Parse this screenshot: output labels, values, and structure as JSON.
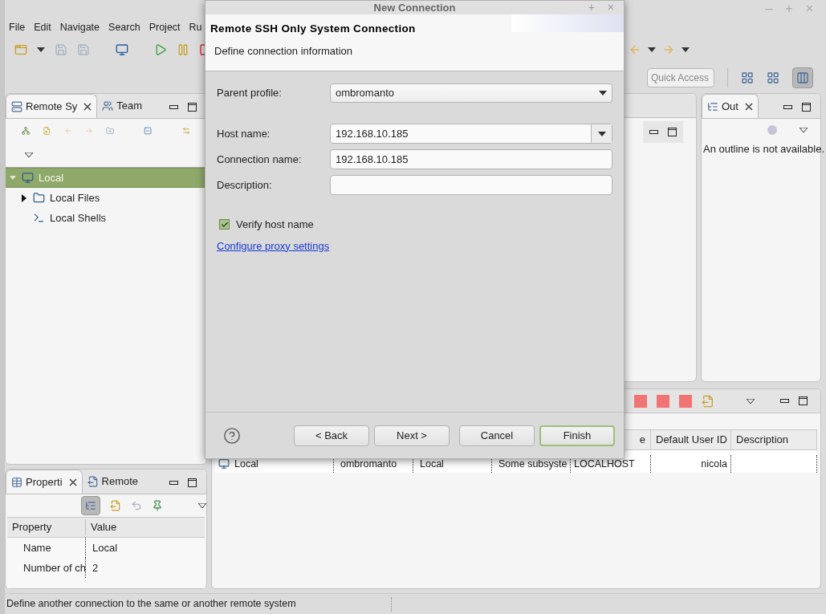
{
  "window": {
    "controls": [
      "–",
      "+",
      "×"
    ]
  },
  "menu": [
    "File",
    "Edit",
    "Navigate",
    "Search",
    "Project",
    "Ru"
  ],
  "quick_access": {
    "placeholder": "Quick Access"
  },
  "remote_systems_view": {
    "tabs": [
      {
        "label": "Remote Sy",
        "selected": true
      },
      {
        "label": "Team",
        "selected": false
      }
    ],
    "tree": [
      {
        "label": "Local",
        "selected": true,
        "expanded": true,
        "children": [
          {
            "label": "Local Files",
            "selected": false,
            "expanded": false
          },
          {
            "label": "Local Shells",
            "selected": false
          }
        ]
      }
    ]
  },
  "outline_view": {
    "tabs": [
      {
        "label": "Out",
        "selected": true
      }
    ],
    "message": "An outline is not available."
  },
  "connections_table": {
    "columns": [
      "",
      "",
      "",
      "",
      "e",
      "Default User ID",
      "Description"
    ],
    "rows": [
      {
        "cells": [
          "Local",
          "ombromanto",
          "Local",
          "Some subsyste",
          "LOCALHOST",
          "nicola"
        ]
      }
    ]
  },
  "properties_view": {
    "tabs": [
      {
        "label": "Properti",
        "selected": true
      },
      {
        "label": "Remote",
        "selected": false
      }
    ],
    "columns": [
      "Property",
      "Value"
    ],
    "rows": [
      [
        "Name",
        "Local"
      ],
      [
        "Number of ch",
        "2"
      ]
    ]
  },
  "status_bar": "Define another connection to the same or another remote system",
  "dialog": {
    "title": "New Connection",
    "controls": [
      "+",
      "×"
    ],
    "heading": "Remote SSH Only System Connection",
    "subheading": "Define connection information",
    "fields": [
      {
        "kind": "select",
        "label": "Parent profile:",
        "value": "ombromanto"
      },
      {
        "kind": "combo",
        "label": "Host name:",
        "value": "192.168.10.185"
      },
      {
        "kind": "text",
        "label": "Connection name:",
        "value": "192.168.10.185"
      },
      {
        "kind": "text",
        "label": "Description:"
      }
    ],
    "verify_host_name": {
      "label": "Verify host name",
      "checked": true
    },
    "proxy_link": "Configure proxy settings",
    "buttons": [
      {
        "label": "< Back",
        "default": false
      },
      {
        "label": "Next >",
        "default": false
      },
      {
        "label": "Cancel",
        "default": false
      },
      {
        "label": "Finish",
        "default": true
      }
    ]
  }
}
